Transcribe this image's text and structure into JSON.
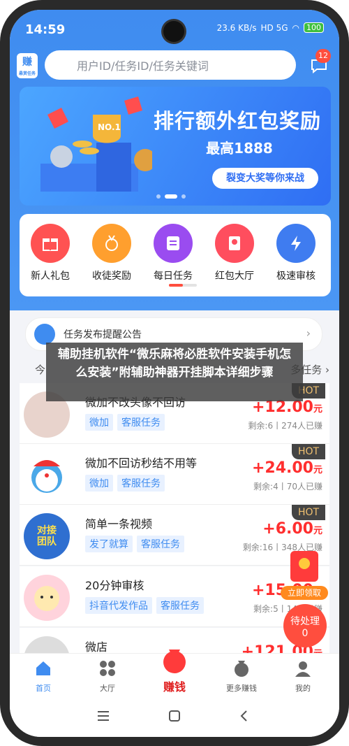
{
  "status_bar": {
    "time": "14:59",
    "network": "23.6 KB/s",
    "signal": "HD 5G",
    "battery": "100"
  },
  "header": {
    "logo_line1": "赚",
    "logo_line2": "悬赏任务",
    "search_placeholder": "用户ID/任务ID/任务关键词",
    "message_badge": "12"
  },
  "banner": {
    "title": "排行额外红包奖励",
    "subtitle": "最高1888",
    "button": "裂变大奖等你来战",
    "trophy_label": "NO.1"
  },
  "categories": [
    {
      "label": "新人礼包",
      "color": "#ff5252",
      "icon": "gift-icon"
    },
    {
      "label": "收徒奖励",
      "color": "#ff9f2e",
      "icon": "medal-icon"
    },
    {
      "label": "每日任务",
      "color": "#9a4cf0",
      "icon": "checklist-icon"
    },
    {
      "label": "红包大厅",
      "color": "#ff4e5e",
      "icon": "red-envelope-icon"
    },
    {
      "label": "极速审核",
      "color": "#3f7cf0",
      "icon": "lightning-icon"
    }
  ],
  "notice": {
    "text": "任务发布提醒公告"
  },
  "tabs": {
    "today": "今",
    "more": "多任务 ›"
  },
  "overlay": {
    "text": "辅助挂机软件“微乐麻将必胜软件安装手机怎么安装”附辅助神器开挂脚本详细步骤"
  },
  "tasks": [
    {
      "title": "微加不改头像不回访",
      "tags": [
        "微加",
        "客服任务"
      ],
      "price": "+12.00",
      "unit": "元",
      "remain": "剩余:6丨274人已赚",
      "hot": "HOT"
    },
    {
      "title": "微加不回访秒结不用等",
      "tags": [
        "微加",
        "客服任务"
      ],
      "price": "+24.00",
      "unit": "元",
      "remain": "剩余:4丨70人已赚",
      "hot": "HOT"
    },
    {
      "title": "简单一条视频",
      "tags": [
        "发了就算",
        "客服任务"
      ],
      "price": "+6.00",
      "unit": "元",
      "remain": "剩余:16丨348人已赚",
      "hot": "HOT",
      "avatar_text": "对接团队"
    },
    {
      "title": "20分钟审核",
      "tags": [
        "抖音代发作品",
        "客服任务"
      ],
      "price": "+15.00",
      "unit": "元",
      "remain": "剩余:5丨14人已赚",
      "hot": ""
    },
    {
      "title": "微店",
      "tags": [],
      "price": "+121.00",
      "unit": "元",
      "remain": "",
      "hot": ""
    }
  ],
  "float": {
    "gift_label": "立即领取",
    "pending_label": "待处理",
    "pending_count": "0"
  },
  "bottom_nav": [
    {
      "label": "首页",
      "active": true
    },
    {
      "label": "大厅",
      "active": false
    },
    {
      "label": "赚钱",
      "active": false
    },
    {
      "label": "更多赚钱",
      "active": false
    },
    {
      "label": "我的",
      "active": false
    }
  ],
  "colors": {
    "primary": "#3f8cf0",
    "red": "#ff2e2e",
    "hot_bg": "#444444"
  }
}
